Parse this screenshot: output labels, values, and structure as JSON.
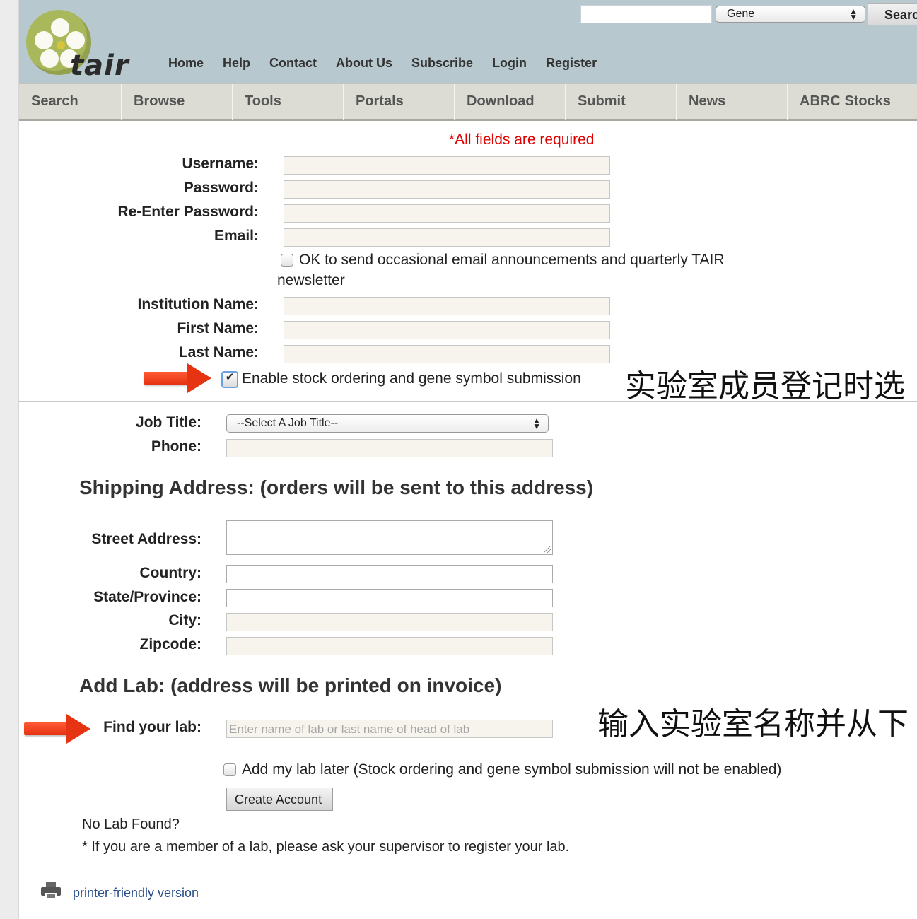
{
  "header": {
    "logo_text": "tair",
    "search_query": "",
    "search_type": "Gene",
    "search_button": "Search",
    "top_links": [
      "Home",
      "Help",
      "Contact",
      "About Us",
      "Subscribe",
      "Login",
      "Register"
    ]
  },
  "main_nav": [
    "Search",
    "Browse",
    "Tools",
    "Portals",
    "Download",
    "Submit",
    "News",
    "ABRC Stocks"
  ],
  "form": {
    "required_note": "*All fields are required",
    "username_label": "Username:",
    "password_label": "Password:",
    "reenter_password_label": "Re-Enter Password:",
    "email_label": "Email:",
    "announce_line1": "OK to send occasional email announcements and quarterly TAIR",
    "announce_line2": "newsletter",
    "institution_label": "Institution Name:",
    "first_name_label": "First Name:",
    "last_name_label": "Last Name:",
    "enable_stock_label": "Enable stock ordering and gene symbol submission",
    "enable_stock_checked": true,
    "job_title_label": "Job Title:",
    "job_title_value": "--Select A Job Title--",
    "phone_label": "Phone:"
  },
  "shipping": {
    "heading": "Shipping Address: (orders will be sent to this address)",
    "street_label": "Street Address:",
    "country_label": "Country:",
    "state_label": "State/Province:",
    "city_label": "City:",
    "zip_label": "Zipcode:"
  },
  "lab": {
    "heading": "Add Lab: (address will be printed on invoice)",
    "find_label": "Find your lab:",
    "find_placeholder": "Enter name of lab or last name of head of lab",
    "later_label": "Add my lab later (Stock ordering and gene symbol submission will not be enabled)",
    "create_button": "Create Account",
    "no_lab": "No Lab Found?",
    "supervisor_note": "* If you are a member of a lab, please ask your supervisor to register your lab."
  },
  "footer": {
    "printer_link": "printer-friendly version"
  },
  "annotations": {
    "note1": "实验室成员登记时选",
    "note2": "输入实验室名称并从下"
  },
  "colors": {
    "header_bg": "#b7c8cf",
    "nav_bg": "#dcdcd5",
    "required_red": "#e00000",
    "arrow_red": "#e63312",
    "link_blue": "#2b4f8a"
  }
}
